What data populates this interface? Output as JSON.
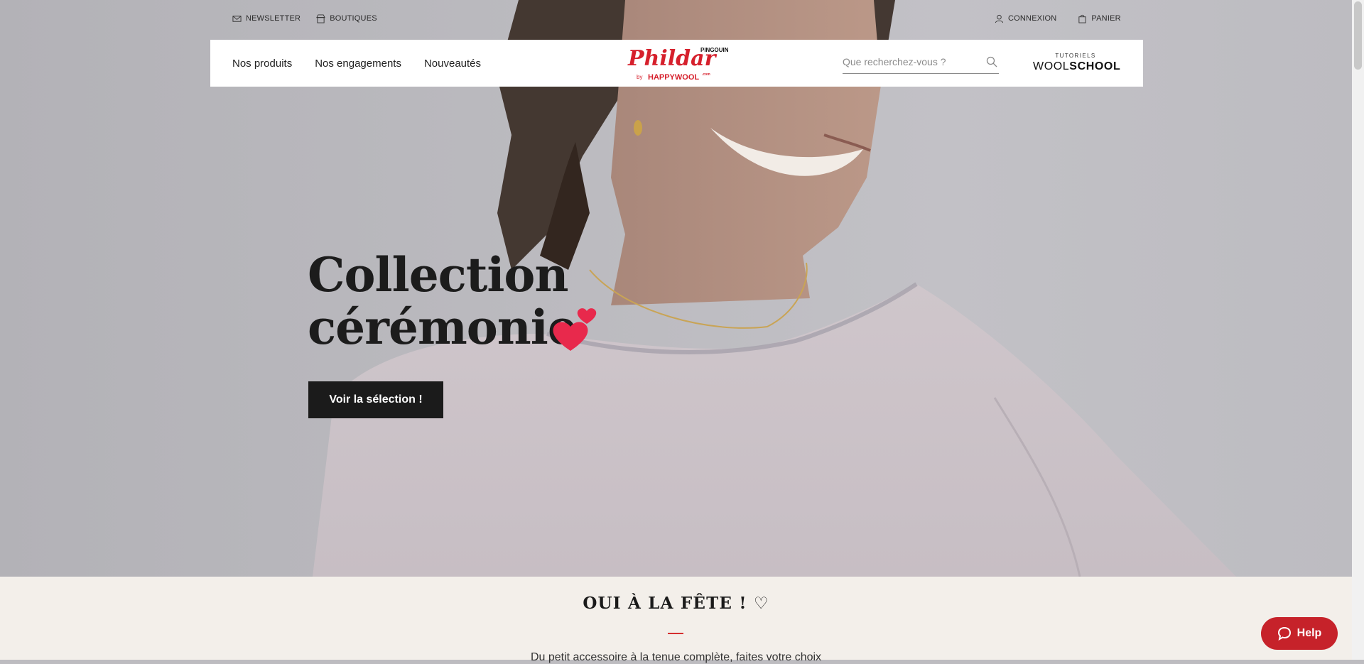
{
  "utility": {
    "newsletter": "NEWSLETTER",
    "boutiques": "BOUTIQUES",
    "connexion": "CONNEXION",
    "panier": "PANIER"
  },
  "nav": {
    "items": [
      {
        "label": "Nos produits"
      },
      {
        "label": "Nos engagements"
      },
      {
        "label": "Nouveautés"
      }
    ]
  },
  "logo": {
    "brand": "Phildar",
    "by": "by",
    "partner": "HAPPYWOOL",
    "partner_suffix": ".com",
    "partner_brand": "PINGOUIN"
  },
  "search": {
    "placeholder": "Que recherchez-vous ?"
  },
  "woolschool": {
    "small": "TUTORIELS",
    "light": "WOOL",
    "bold": "SCHOOL"
  },
  "hero": {
    "title_line1": "Collection",
    "title_line2": "cérémonie",
    "cta": "Voir la sélection !"
  },
  "section": {
    "title": "OUI À LA FÊTE ! ♡",
    "text": "Du petit accessoire à la tenue complète, faites votre choix"
  },
  "help": {
    "label": "Help"
  },
  "colors": {
    "accent": "#e8294c",
    "brand_red": "#d6202c",
    "help": "#c6222a",
    "cta": "#1b1b1b"
  },
  "icons": [
    "mail-icon",
    "store-icon",
    "user-icon",
    "bag-icon",
    "search-icon",
    "hearts-icon",
    "chat-bubble-icon"
  ]
}
